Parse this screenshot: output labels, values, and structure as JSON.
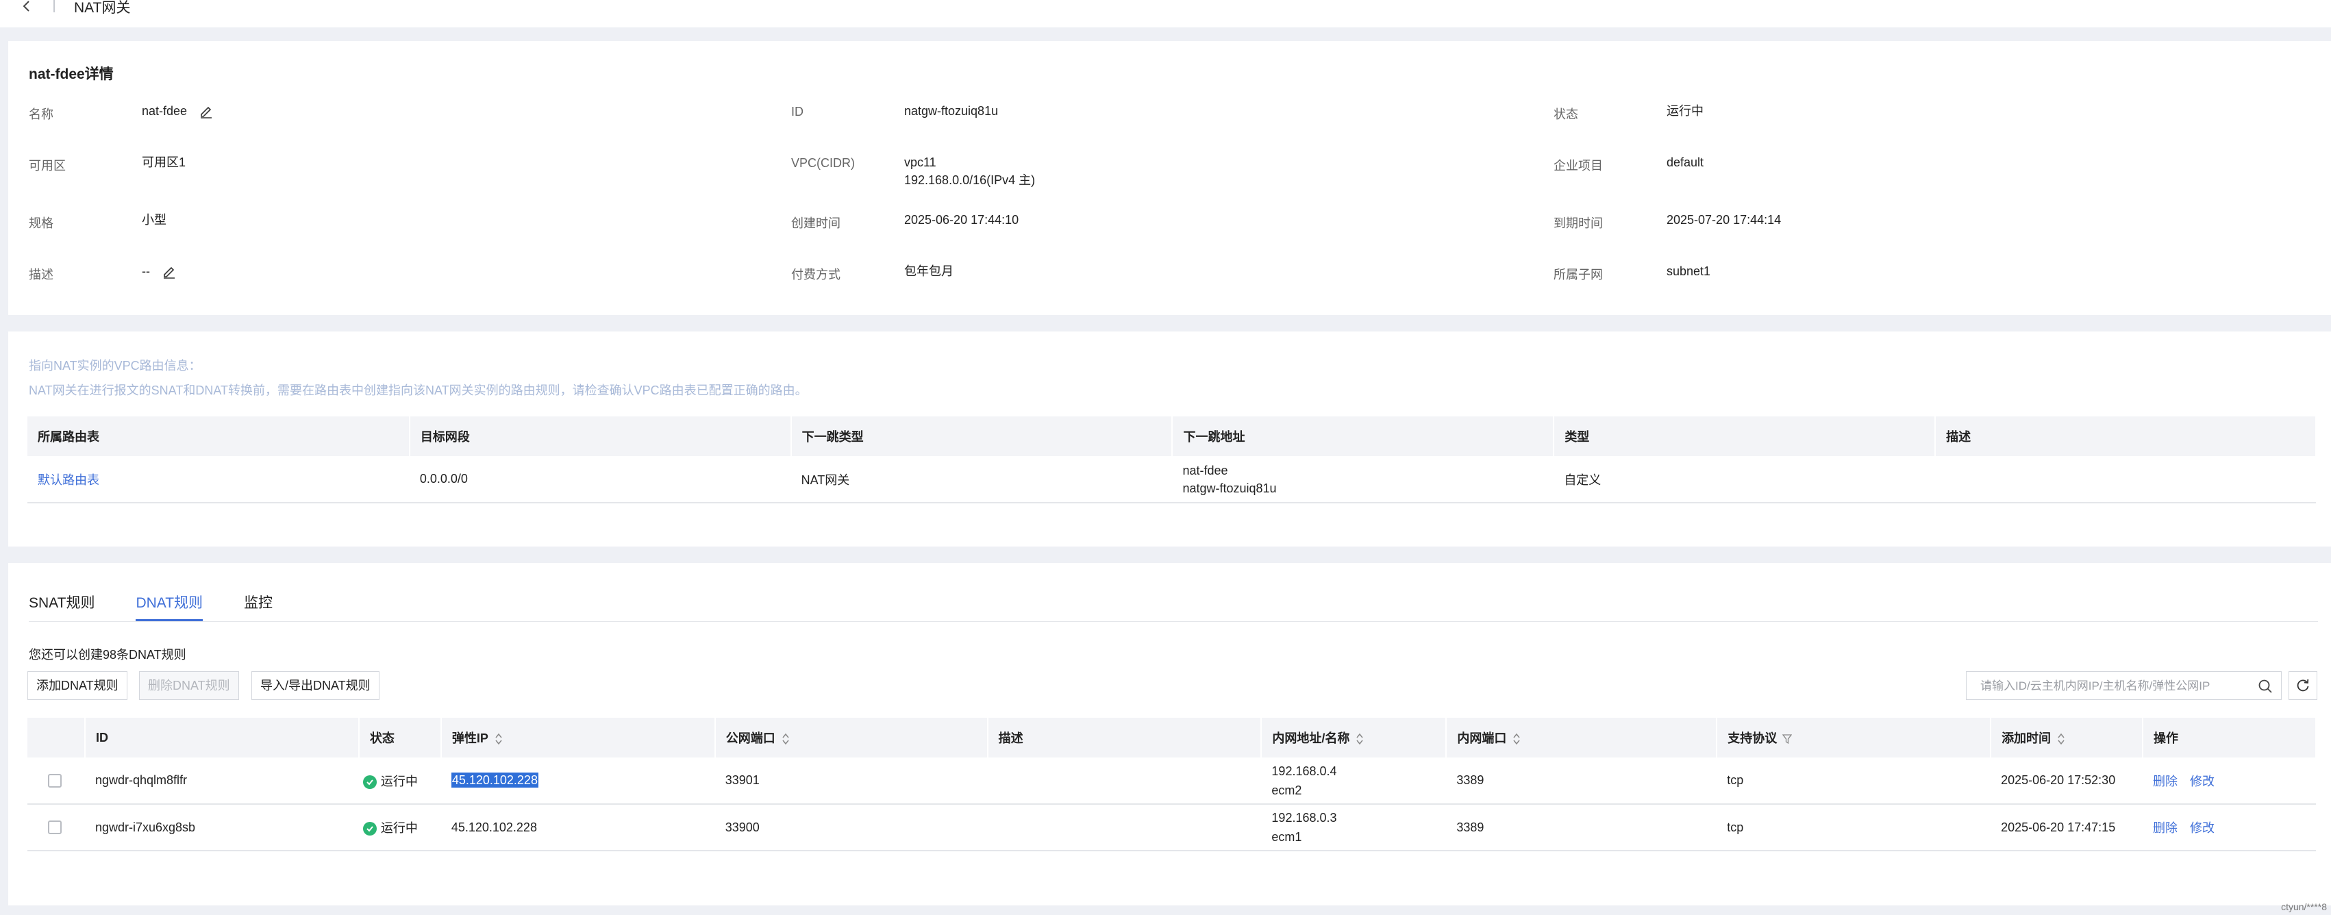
{
  "header": {
    "title": "NAT网关"
  },
  "detail": {
    "title": "nat-fdee详情",
    "fields": {
      "name": {
        "label": "名称",
        "value": "nat-fdee"
      },
      "id": {
        "label": "ID",
        "value": "natgw-ftozuiq81u"
      },
      "status": {
        "label": "状态",
        "value": "运行中"
      },
      "az": {
        "label": "可用区",
        "value": "可用区1"
      },
      "vpc": {
        "label": "VPC(CIDR)",
        "value": "vpc11",
        "value2": "192.168.0.0/16(IPv4 主)"
      },
      "project": {
        "label": "企业项目",
        "value": "default"
      },
      "spec": {
        "label": "规格",
        "value": "小型"
      },
      "created": {
        "label": "创建时间",
        "value": "2025-06-20 17:44:10"
      },
      "expire": {
        "label": "到期时间",
        "value": "2025-07-20 17:44:14"
      },
      "desc": {
        "label": "描述",
        "value": "--"
      },
      "billing": {
        "label": "付费方式",
        "value": "包年包月"
      },
      "subnet": {
        "label": "所属子网",
        "value": "subnet1"
      }
    }
  },
  "route": {
    "info1": "指向NAT实例的VPC路由信息：",
    "info2": "NAT网关在进行报文的SNAT和DNAT转换前，需要在路由表中创建指向该NAT网关实例的路由规则，请检查确认VPC路由表已配置正确的路由。",
    "columns": [
      "所属路由表",
      "目标网段",
      "下一跳类型",
      "下一跳地址",
      "类型",
      "描述"
    ],
    "rows": [
      {
        "table": "默认路由表",
        "dest": "0.0.0.0/0",
        "hop_type": "NAT网关",
        "hop_addr1": "nat-fdee",
        "hop_addr2": "natgw-ftozuiq81u",
        "type": "自定义",
        "desc": ""
      }
    ]
  },
  "rules": {
    "tabs": [
      "SNAT规则",
      "DNAT规则",
      "监控"
    ],
    "active_tab": "DNAT规则",
    "quota": "您还可以创建98条DNAT规则",
    "buttons": {
      "add": "添加DNAT规则",
      "delete": "删除DNAT规则",
      "import": "导入/导出DNAT规则"
    },
    "search_placeholder": "请输入ID/云主机内网IP/主机名称/弹性公网IP",
    "columns": [
      "ID",
      "状态",
      "弹性IP",
      "公网端口",
      "描述",
      "内网地址/名称",
      "内网端口",
      "支持协议",
      "添加时间",
      "操作"
    ],
    "rows": [
      {
        "id": "ngwdr-qhqlm8flfr",
        "status": "运行中",
        "eip": "45.120.102.228",
        "eip_selected": true,
        "pub_port": "33901",
        "desc": "",
        "inner1": "192.168.0.4",
        "inner2": "ecm2",
        "inner_port": "3389",
        "protocol": "tcp",
        "time": "2025-06-20 17:52:30",
        "op_delete": "删除",
        "op_edit": "修改"
      },
      {
        "id": "ngwdr-i7xu6xg8sb",
        "status": "运行中",
        "eip": "45.120.102.228",
        "eip_selected": false,
        "pub_port": "33900",
        "desc": "",
        "inner1": "192.168.0.3",
        "inner2": "ecm1",
        "inner_port": "3389",
        "protocol": "tcp",
        "time": "2025-06-20 17:47:15",
        "op_delete": "删除",
        "op_edit": "修改"
      }
    ]
  },
  "watermark": "ctyun/****8",
  "colors": {
    "accent": "#3f6fd8",
    "status_ok": "#2bb673",
    "page_bg": "#eef0f5",
    "info_text": "#a8b9d8"
  }
}
